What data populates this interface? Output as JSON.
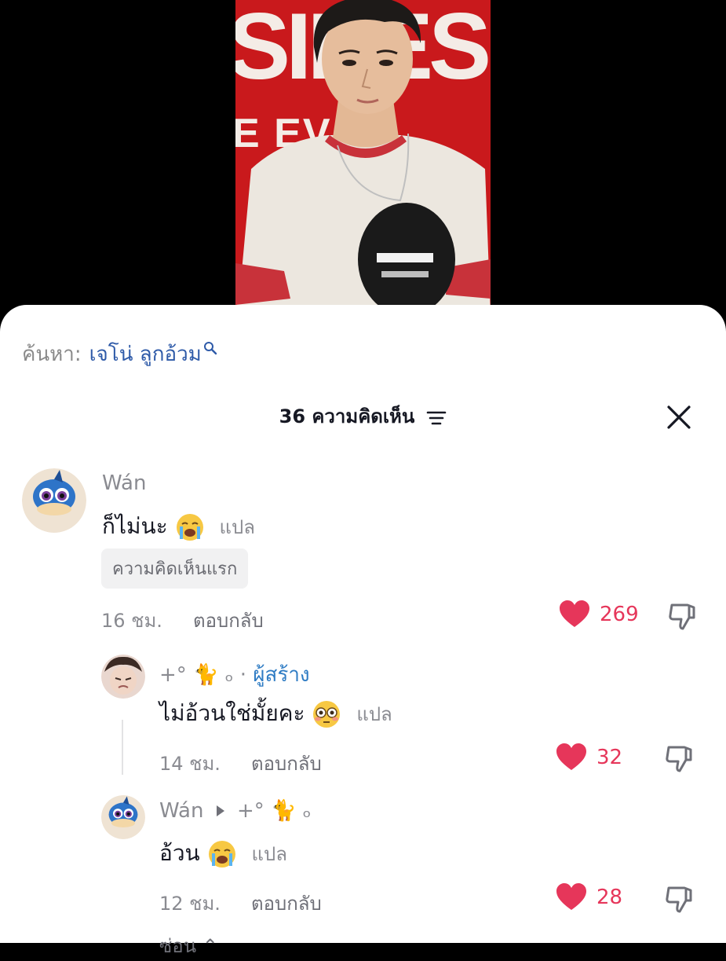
{
  "search": {
    "prefix": "ค้นหา:",
    "term": "เจโน่ ลูกอ้วม"
  },
  "header": {
    "comment_count": "36 ความคิดเห็น"
  },
  "comments": [
    {
      "username": "Wán",
      "text": "ก็ไม่นะ",
      "emoji": "crying-face",
      "translate": "แปล",
      "badge": "ความคิดเห็นแรก",
      "time": "16 ชม.",
      "reply": "ตอบกลับ",
      "likes": "269"
    }
  ],
  "replies": [
    {
      "username": "+° 🐈 ₒ",
      "separator": "·",
      "creator_label": "ผู้สร้าง",
      "text": "ไม่อ้วนใช่มั้ยคะ",
      "emoji": "flushed-face",
      "translate": "แปล",
      "time": "14 ชม.",
      "reply": "ตอบกลับ",
      "likes": "32"
    },
    {
      "username": "Wán",
      "reply_to": "+° 🐈 ₒ",
      "text": "อ้วน",
      "emoji": "crying-face",
      "translate": "แปล",
      "time": "12 ชม.",
      "reply": "ตอบกลับ",
      "likes": "28"
    }
  ],
  "more": {
    "label": "ซ่อน ⌃"
  },
  "colors": {
    "like": "#e6365a",
    "search_term": "#2e5aa8",
    "creator": "#2f7cc4"
  }
}
